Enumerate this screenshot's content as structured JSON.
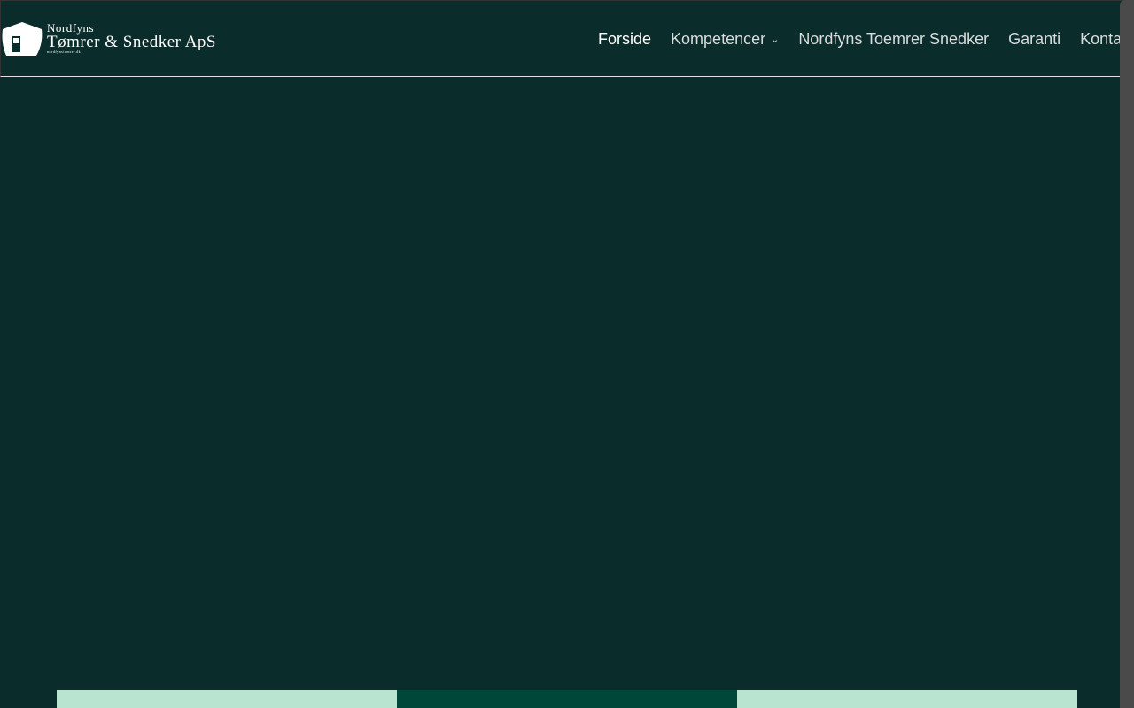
{
  "logo": {
    "line1": "Nordfyns",
    "line2": "Tømrer & Snedker ApS",
    "line3": "nordfynstomrer.dk"
  },
  "nav": [
    {
      "label": "Forside",
      "active": true
    },
    {
      "label": "Kompetencer",
      "dropdown": true
    },
    {
      "label": "Nordfyns Toemrer Snedker"
    },
    {
      "label": "Garanti"
    },
    {
      "label": "Kontakt"
    }
  ],
  "colors": {
    "background": "#0a2c2b",
    "box_light": "#b9e4d0",
    "box_dark": "#00473a"
  }
}
